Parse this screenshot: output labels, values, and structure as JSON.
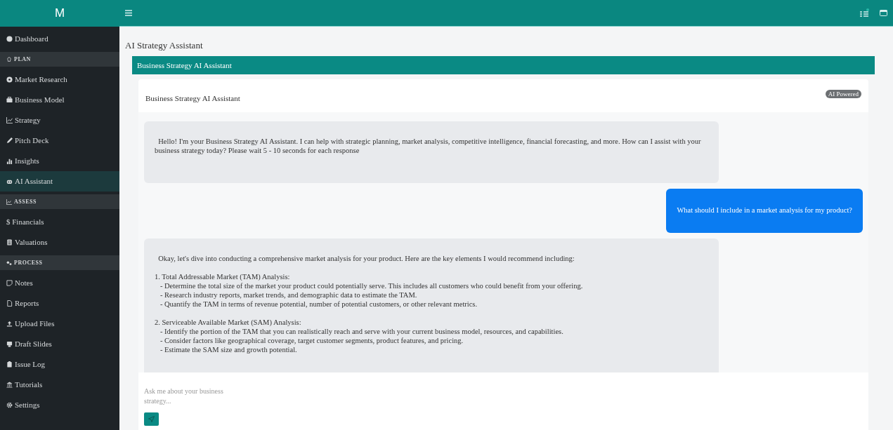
{
  "sidebar": {
    "logo": "M",
    "items": [
      {
        "kind": "link",
        "label": "Dashboard",
        "selected": false
      },
      {
        "kind": "section",
        "label": "PLAN"
      },
      {
        "kind": "link",
        "label": "Market Research",
        "selected": false
      },
      {
        "kind": "link",
        "label": "Business Model",
        "selected": false
      },
      {
        "kind": "link",
        "label": "Strategy",
        "selected": false
      },
      {
        "kind": "link",
        "label": "Pitch Deck",
        "selected": false
      },
      {
        "kind": "link",
        "label": "Insights",
        "selected": false
      },
      {
        "kind": "link",
        "label": "AI Assistant",
        "selected": true
      },
      {
        "kind": "section",
        "label": "ASSESS"
      },
      {
        "kind": "link",
        "label": "$ Financials",
        "selected": false
      },
      {
        "kind": "link",
        "label": "Valuations",
        "selected": false
      },
      {
        "kind": "section",
        "label": "PROCESS"
      },
      {
        "kind": "link",
        "label": "Notes",
        "selected": false
      },
      {
        "kind": "link",
        "label": "Reports",
        "selected": false
      },
      {
        "kind": "link",
        "label": "Upload Files",
        "selected": false
      },
      {
        "kind": "link",
        "label": "Draft Slides",
        "selected": false
      },
      {
        "kind": "link",
        "label": "Issue Log",
        "selected": false
      },
      {
        "kind": "link",
        "label": "Tutorials",
        "selected": false
      },
      {
        "kind": "link",
        "label": "Settings",
        "selected": false
      }
    ]
  },
  "page_title": "AI Strategy Assistant",
  "panel": {
    "title": "Business Strategy AI Assistant",
    "card_title": "Business Strategy AI Assistant",
    "badge": "AI Powered"
  },
  "messages": [
    {
      "kind": "assistant",
      "text": "  Hello! I'm your Business Strategy AI Assistant. I can help with strategic planning, market analysis, competitive intelligence, financial forecasting, and more. How can I assist with your business strategy today? Please wait 5 - 10 seconds for each response"
    },
    {
      "kind": "user",
      "text": "What should I include in a market analysis for my product?"
    },
    {
      "kind": "assistant",
      "text": "  Okay, let's dive into conducting a comprehensive market analysis for your product. Here are the key elements I would recommend including:\n\n1. Total Addressable Market (TAM) Analysis:\n   - Determine the total size of the market your product could potentially serve. This includes all customers who could benefit from your offering.\n   - Research industry reports, market trends, and demographic data to estimate the TAM.\n   - Quantify the TAM in terms of revenue potential, number of potential customers, or other relevant metrics.\n\n2. Serviceable Available Market (SAM) Analysis:\n   - Identify the portion of the TAM that you can realistically reach and serve with your current business model, resources, and capabilities.\n   - Consider factors like geographical coverage, target customer segments, product features, and pricing.\n   - Estimate the SAM size and growth potential."
    }
  ],
  "input": {
    "placeholder": "Ask me about your business strategy..."
  }
}
